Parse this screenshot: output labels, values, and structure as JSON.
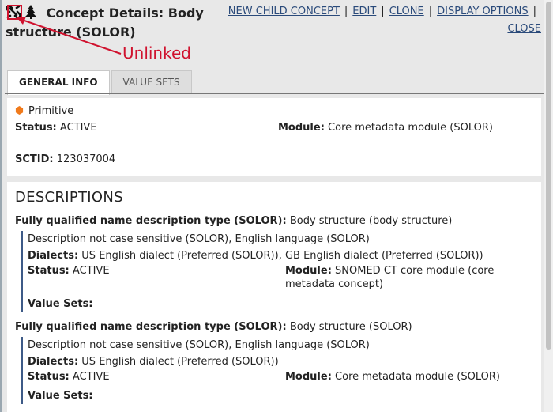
{
  "header": {
    "title": "Concept Details: Body structure (SOLOR)",
    "actions": [
      "NEW CHILD CONCEPT",
      "EDIT",
      "CLONE",
      "DISPLAY OPTIONS",
      "CLOSE"
    ],
    "separator": "|"
  },
  "annotation": {
    "label": "Unlinked",
    "color": "#d0122e"
  },
  "icons": {
    "link_status": "unlinked-chain-icon",
    "concept_type": "tree-icon",
    "primitive": "orange-hexagon-icon"
  },
  "tabs": [
    {
      "label": "GENERAL INFO",
      "active": true
    },
    {
      "label": "VALUE SETS",
      "active": false
    }
  ],
  "general": {
    "primitive_label": "Primitive",
    "status_label": "Status:",
    "status_value": "ACTIVE",
    "module_label": "Module:",
    "module_value": "Core metadata module (SOLOR)",
    "sctid_label": "SCTID:",
    "sctid_value": "123037004"
  },
  "descriptions": {
    "heading": "DESCRIPTIONS",
    "items": [
      {
        "type_label": "Fully qualified name description type (SOLOR):",
        "type_value": "Body structure (body structure)",
        "case_language": "Description not case sensitive (SOLOR), English language (SOLOR)",
        "dialects_label": "Dialects:",
        "dialects_value": "US English dialect (Preferred (SOLOR)), GB English dialect (Preferred (SOLOR))",
        "status_label": "Status:",
        "status_value": "ACTIVE",
        "module_label": "Module:",
        "module_value": "SNOMED CT core module (core metadata concept)",
        "value_sets_label": "Value Sets:"
      },
      {
        "type_label": "Fully qualified name description type (SOLOR):",
        "type_value": "Body structure (SOLOR)",
        "case_language": "Description not case sensitive (SOLOR), English language (SOLOR)",
        "dialects_label": "Dialects:",
        "dialects_value": "US English dialect (Preferred (SOLOR))",
        "status_label": "Status:",
        "status_value": "ACTIVE",
        "module_label": "Module:",
        "module_value": "Core metadata module (SOLOR)",
        "value_sets_label": "Value Sets:"
      }
    ]
  },
  "colors": {
    "link": "#2a4a7a",
    "accent_border": "#3d5a87",
    "primitive_hex": "#f07a1c"
  }
}
